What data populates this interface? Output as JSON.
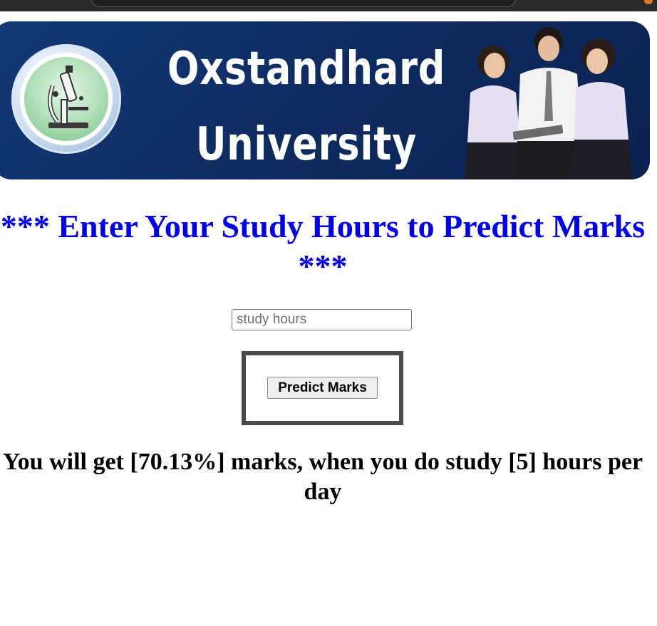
{
  "banner": {
    "title_line1": "Oxstandhard",
    "title_line2": "University"
  },
  "form": {
    "heading": "*** Enter Your Study Hours to Predict Marks ***",
    "input_placeholder": "study hours",
    "input_value": "",
    "button_label": "Predict Marks"
  },
  "result": {
    "text": "You will get [70.13%] marks, when you do study [5] hours per day"
  },
  "colors": {
    "heading": "#0000ee",
    "banner_bg": "#0e2a5e",
    "frame_border": "#4a4a4a"
  },
  "icons": {
    "logo": "microscope-logo-icon"
  }
}
